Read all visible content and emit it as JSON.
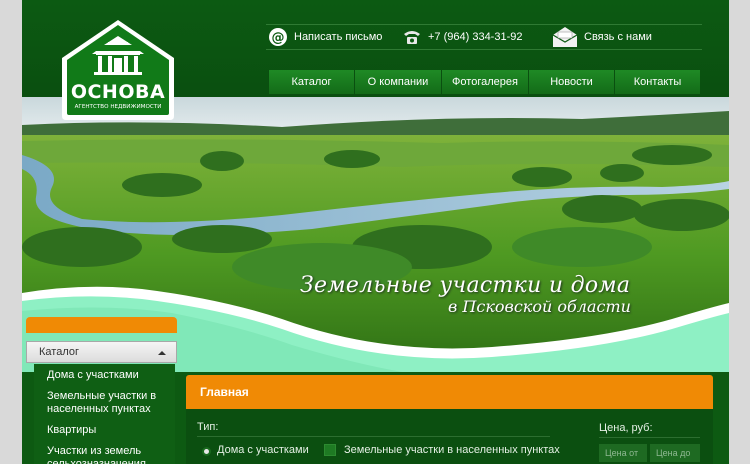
{
  "logo": {
    "name": "ОСНОВА",
    "tagline": "АГЕНТСТВО НЕДВИЖИМОСТИ"
  },
  "contacts": {
    "email_label": "Написать письмо",
    "phone": "+7 (964) 334-31-92",
    "feedback_label": "Связь с нами"
  },
  "nav": [
    "Каталог",
    "О компании",
    "Фотогалерея",
    "Новости",
    "Контакты"
  ],
  "banner": {
    "title": "Земельные участки и дома",
    "subtitle": "в Псковской области"
  },
  "sidebar": {
    "select_value": "Каталог",
    "items": [
      "Дома с участками",
      "Земельные участки в населенных пунктах",
      "Квартиры",
      "Участки из земель сельхозназначения"
    ]
  },
  "main": {
    "heading": "Главная",
    "type_label": "Тип:",
    "options": [
      "Дома с участками",
      "Земельные участки в населенных пунктах"
    ],
    "price_label": "Цена, руб:",
    "price_from_placeholder": "Цена от",
    "price_to_placeholder": "Цена до"
  },
  "colors": {
    "header_green": "#0c5a12",
    "accent_orange": "#f08a05",
    "nav_green": "#1f8a25"
  }
}
